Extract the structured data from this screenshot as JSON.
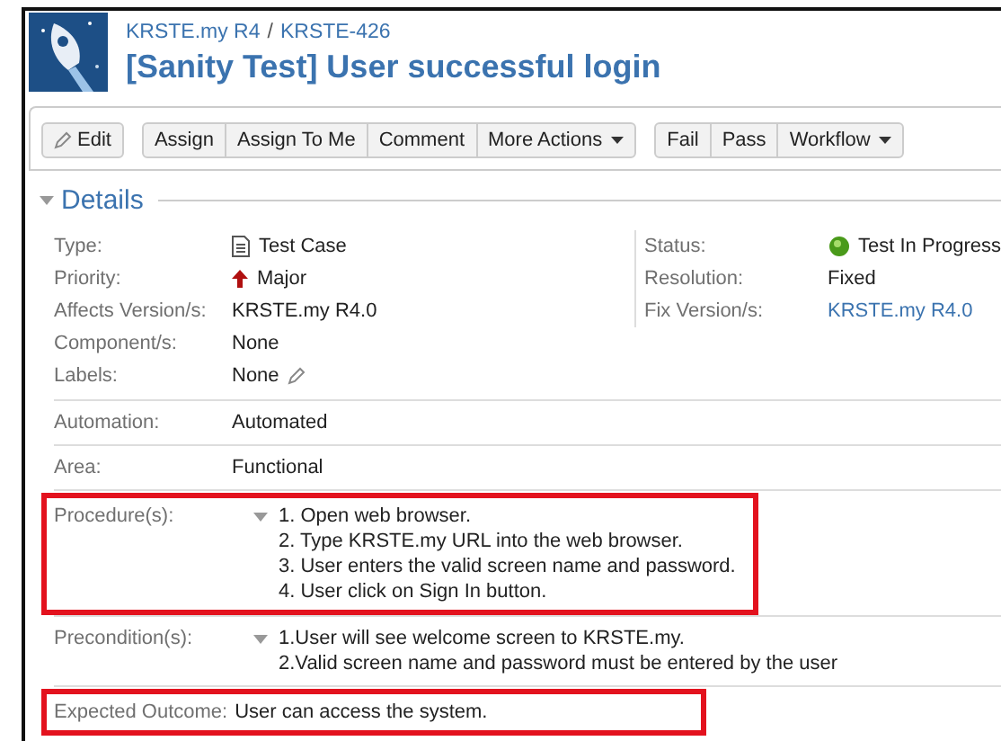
{
  "breadcrumb": [
    "KRSTE.my R4",
    "KRSTE-426"
  ],
  "breadcrumb_separator": "/",
  "title": "[Sanity Test] User successful login",
  "toolbar": [
    {
      "buttons": [
        {
          "label": "Edit",
          "kind": "edit"
        }
      ]
    },
    {
      "buttons": [
        {
          "label": "Assign",
          "kind": "plain"
        },
        {
          "label": "Assign To Me",
          "kind": "plain"
        },
        {
          "label": "Comment",
          "kind": "plain"
        },
        {
          "label": "More Actions",
          "kind": "menu"
        }
      ]
    },
    {
      "buttons": [
        {
          "label": "Fail",
          "kind": "plain"
        },
        {
          "label": "Pass",
          "kind": "plain"
        },
        {
          "label": "Workflow",
          "kind": "menu"
        }
      ]
    }
  ],
  "details": {
    "heading": "Details",
    "expanded": true,
    "left_fields": [
      {
        "label": "Type:",
        "value": "Test Case",
        "kind": "type"
      },
      {
        "label": "Priority:",
        "value": "Major",
        "kind": "priority"
      },
      {
        "label": "Affects Version/s:",
        "value": "KRSTE.my R4.0",
        "kind": "text"
      },
      {
        "label": "Component/s:",
        "value": "None",
        "kind": "text"
      },
      {
        "label": "Labels:",
        "value": "None",
        "kind": "labels"
      }
    ],
    "right_fields": [
      {
        "label": "Status:",
        "value": "Test In Progress",
        "kind": "status"
      },
      {
        "label": "Resolution:",
        "value": "Fixed",
        "kind": "text"
      },
      {
        "label": "Fix Version/s:",
        "value": "KRSTE.my R4.0",
        "kind": "link"
      }
    ]
  },
  "custom_fields": [
    {
      "label": "Automation:",
      "kind": "text",
      "value": "Automated",
      "highlighted": false
    },
    {
      "label": "Area:",
      "kind": "text",
      "value": "Functional",
      "highlighted": false
    },
    {
      "label": "Procedure(s):",
      "kind": "list",
      "expanded": true,
      "highlighted": true,
      "items": [
        "1. Open web browser.",
        "2. Type KRSTE.my URL into the web browser.",
        "3. User enters the valid screen name and password.",
        "4. User click on Sign In button."
      ]
    },
    {
      "label": "Precondition(s):",
      "kind": "list",
      "expanded": true,
      "highlighted": false,
      "items": [
        "1.User will see welcome screen to KRSTE.my.",
        "2.Valid screen name and password must be entered by the user"
      ]
    },
    {
      "label": "Expected Outcome:",
      "kind": "text",
      "value": "User can access the system.",
      "highlighted": true
    }
  ]
}
